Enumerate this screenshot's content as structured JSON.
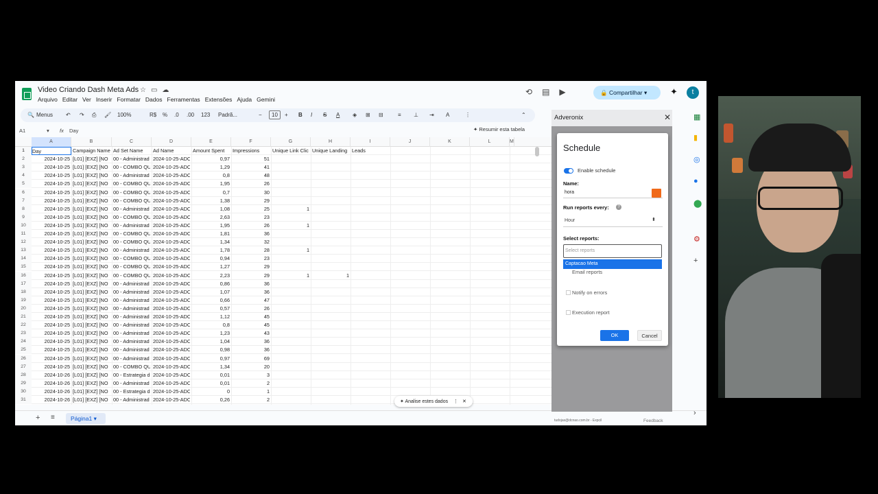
{
  "doc": {
    "title": "Video Criando Dash Meta Ads",
    "menus": [
      "Arquivo",
      "Editar",
      "Ver",
      "Inserir",
      "Formatar",
      "Dados",
      "Ferramentas",
      "Extensões",
      "Ajuda",
      "Gemini"
    ],
    "share_label": "Compartilhar",
    "avatar_letter": "t"
  },
  "toolbar": {
    "search_label": "Menus",
    "zoom": "100%",
    "currency": "R$",
    "percent": "%",
    "dec_less": ".0",
    "dec_more": ".00",
    "number_format": "123",
    "font": "Padrã...",
    "font_size": "10"
  },
  "formula": {
    "cell_ref": "A1",
    "fx": "fx",
    "value": "Day",
    "summarize": "Resumir esta tabela"
  },
  "columns": [
    "A",
    "B",
    "C",
    "D",
    "E",
    "F",
    "G",
    "H",
    "I",
    "J",
    "K",
    "L",
    "M"
  ],
  "headers": [
    "Day",
    "Campaign Name",
    "Ad Set Name",
    "Ad Name",
    "Amount Spent",
    "Impressions",
    "Unique Link Clic",
    "Unique Landing",
    "Leads"
  ],
  "rows": [
    [
      "2",
      "2024-10-25",
      "[L01] [EXZ] [NO",
      "00 - Administrad",
      "2024-10-25-ADC",
      "0,97",
      "51",
      "",
      ""
    ],
    [
      "3",
      "2024-10-25",
      "[L01] [EXZ] [NO",
      "00 - COMBO QU",
      "2024-10-25-ADC",
      "1,29",
      "41",
      "",
      ""
    ],
    [
      "4",
      "2024-10-25",
      "[L01] [EXZ] [NO",
      "00 - Administrad",
      "2024-10-25-ADC",
      "0,8",
      "48",
      "",
      ""
    ],
    [
      "5",
      "2024-10-25",
      "[L01] [EXZ] [NO",
      "00 - COMBO QU",
      "2024-10-25-ADC",
      "1,95",
      "26",
      "",
      ""
    ],
    [
      "6",
      "2024-10-25",
      "[L01] [EXZ] [NO",
      "00 - COMBO QU",
      "2024-10-25-ADC",
      "0,7",
      "30",
      "",
      ""
    ],
    [
      "7",
      "2024-10-25",
      "[L01] [EXZ] [NO",
      "00 - COMBO QU",
      "2024-10-25-ADC",
      "1,38",
      "29",
      "",
      ""
    ],
    [
      "8",
      "2024-10-25",
      "[L01] [EXZ] [NO",
      "00 - Administrad",
      "2024-10-25-ADC",
      "1,08",
      "25",
      "1",
      ""
    ],
    [
      "9",
      "2024-10-25",
      "[L01] [EXZ] [NO",
      "00 - COMBO QU",
      "2024-10-25-ADC",
      "2,63",
      "23",
      "",
      ""
    ],
    [
      "10",
      "2024-10-25",
      "[L01] [EXZ] [NO",
      "00 - Administrad",
      "2024-10-25-ADC",
      "1,95",
      "26",
      "1",
      ""
    ],
    [
      "11",
      "2024-10-25",
      "[L01] [EXZ] [NO",
      "00 - COMBO QU",
      "2024-10-25-ADC",
      "1,81",
      "36",
      "",
      ""
    ],
    [
      "12",
      "2024-10-25",
      "[L01] [EXZ] [NO",
      "00 - COMBO QU",
      "2024-10-25-ADC",
      "1,34",
      "32",
      "",
      ""
    ],
    [
      "13",
      "2024-10-25",
      "[L01] [EXZ] [NO",
      "00 - Administrad",
      "2024-10-25-ADC",
      "1,78",
      "28",
      "1",
      ""
    ],
    [
      "14",
      "2024-10-25",
      "[L01] [EXZ] [NO",
      "00 - COMBO QU",
      "2024-10-25-ADC",
      "0,94",
      "23",
      "",
      ""
    ],
    [
      "15",
      "2024-10-25",
      "[L01] [EXZ] [NO",
      "00 - COMBO QU",
      "2024-10-25-ADC",
      "1,27",
      "29",
      "",
      ""
    ],
    [
      "16",
      "2024-10-25",
      "[L01] [EXZ] [NO",
      "00 - COMBO QU",
      "2024-10-25-ADC",
      "2,23",
      "29",
      "1",
      "1"
    ],
    [
      "17",
      "2024-10-25",
      "[L01] [EXZ] [NO",
      "00 - Administrad",
      "2024-10-25-ADC",
      "0,86",
      "36",
      "",
      ""
    ],
    [
      "18",
      "2024-10-25",
      "[L01] [EXZ] [NO",
      "00 - Administrad",
      "2024-10-25-ADC",
      "1,07",
      "36",
      "",
      ""
    ],
    [
      "19",
      "2024-10-25",
      "[L01] [EXZ] [NO",
      "00 - Administrad",
      "2024-10-25-ADC",
      "0,66",
      "47",
      "",
      ""
    ],
    [
      "20",
      "2024-10-25",
      "[L01] [EXZ] [NO",
      "00 - Administrad",
      "2024-10-25-ADC",
      "0,57",
      "26",
      "",
      ""
    ],
    [
      "21",
      "2024-10-25",
      "[L01] [EXZ] [NO",
      "00 - Administrad",
      "2024-10-25-ADC",
      "1,12",
      "45",
      "",
      ""
    ],
    [
      "22",
      "2024-10-25",
      "[L01] [EXZ] [NO",
      "00 - Administrad",
      "2024-10-25-ADC",
      "0,8",
      "45",
      "",
      ""
    ],
    [
      "23",
      "2024-10-25",
      "[L01] [EXZ] [NO",
      "00 - Administrad",
      "2024-10-25-ADC",
      "1,23",
      "43",
      "",
      ""
    ],
    [
      "24",
      "2024-10-25",
      "[L01] [EXZ] [NO",
      "00 - Administrad",
      "2024-10-25-ADC",
      "1,04",
      "36",
      "",
      ""
    ],
    [
      "25",
      "2024-10-25",
      "[L01] [EXZ] [NO",
      "00 - Administrad",
      "2024-10-25-ADC",
      "0,98",
      "36",
      "",
      ""
    ],
    [
      "26",
      "2024-10-25",
      "[L01] [EXZ] [NO",
      "00 - Administrad",
      "2024-10-25-ADC",
      "0,97",
      "69",
      "",
      ""
    ],
    [
      "27",
      "2024-10-25",
      "[L01] [EXZ] [NO",
      "00 - COMBO QU",
      "2024-10-25-ADC",
      "1,34",
      "20",
      "",
      ""
    ],
    [
      "28",
      "2024-10-26",
      "[L01] [EXZ] [NO",
      "00 - Estrategia d",
      "2024-10-25-ADC",
      "0,01",
      "3",
      "",
      ""
    ],
    [
      "29",
      "2024-10-26",
      "[L01] [EXZ] [NO",
      "00 - Administrad",
      "2024-10-25-ADC",
      "0,01",
      "2",
      "",
      ""
    ],
    [
      "30",
      "2024-10-26",
      "[L01] [EXZ] [NO",
      "00 - Estrategia d",
      "2024-10-25-ADC",
      "0",
      "1",
      "",
      ""
    ],
    [
      "31",
      "2024-10-26",
      "[L01] [EXZ] [NO",
      "00 - Administrad",
      "2024-10-25-ADC",
      "0,26",
      "2",
      "",
      ""
    ]
  ],
  "analise_label": "Analise estes dados",
  "sheet_tab": "Página1",
  "panel": {
    "title": "Adveronix",
    "dialog_title": "Schedule",
    "enable_label": "Enable schedule",
    "name_label": "Name:",
    "name_value": "hora",
    "accent_color": "#f06a1a",
    "run_label": "Run reports every:",
    "run_value": "Hour",
    "select_label": "Select reports:",
    "select_placeholder": "Select reports",
    "dropdown_option": "Captacao Meta",
    "email_label": "Email reports",
    "notify_label": "Notify on errors",
    "exec_label": "Execution report",
    "ok_label": "OK",
    "cancel_label": "Cancel",
    "footer_email": "tudojas@dcnao.com.br - Expcil",
    "feedback_label": "Feedback"
  }
}
